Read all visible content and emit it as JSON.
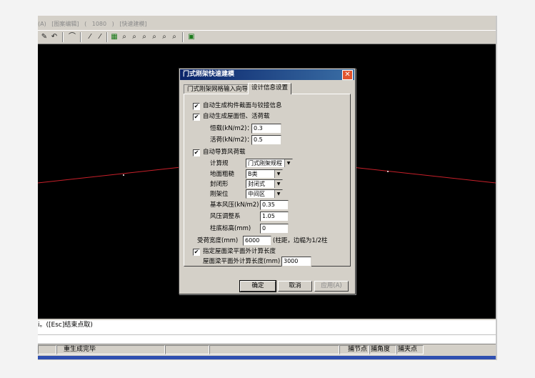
{
  "menubar": {
    "items": [
      "(A)",
      "[图案编辑]",
      "(",
      "1080",
      ")",
      "[快速建模]"
    ]
  },
  "toolbar": {
    "icons": [
      "paint-icon",
      "undo-icon",
      "arc-icon",
      "line-icon",
      "line2-icon",
      "grid-icon",
      "zoom-region-icon",
      "zoom-prev-icon",
      "zoom-all-icon",
      "zoom-in-icon",
      "zoom-out-icon",
      "pan-icon",
      "help-icon"
    ]
  },
  "dialog": {
    "title": "门式刚架快速建模",
    "close_glyph": "✕",
    "tabs": [
      "门式刚架网格输入向导",
      "设计信息设置"
    ],
    "opt_section_bolt": "自动生成构件截面与铰接信息",
    "opt_roof_load": "自动生成屋面恒、活荷载",
    "dead_load_label": "恒载(kN/m2)：",
    "dead_load_value": "0.3",
    "live_load_label": "活荷(kN/m2)：",
    "live_load_value": "0.5",
    "opt_wind": "自动导算风荷载",
    "code_label": "计算规",
    "code_value": "门式刚架规程",
    "rough_label": "地面粗糙",
    "rough_value": "B类",
    "enclose_label": "封闭形",
    "enclose_value": "封闭式",
    "frame_pos_label": "刚架位",
    "frame_pos_value": "中间区",
    "wind_press_label": "基本风压(kN/m2)",
    "wind_press_value": "0.35",
    "wind_adj_label": "风压调整系",
    "wind_adj_value": "1.05",
    "col_base_label": "柱底标高(mm)",
    "col_base_value": "0",
    "load_width_label": "受荷宽度(mm)",
    "load_width_value": "6000",
    "load_width_hint": "(柱距，边榀为1/2柱",
    "opt_outplane": "指定屋面梁平面外计算长度",
    "outplane_label": "屋面梁平面外计算长度(mm)",
    "outplane_value": "3000",
    "check_glyph": "✔",
    "ok_label": "确定",
    "cancel_label": "取消",
    "apply_label": "应用(A)"
  },
  "cmdline": {
    "text": "i。([Esc]结束点取)"
  },
  "statusbar": {
    "message": "重生成完毕",
    "snap_node": "捕节点",
    "snap_angle": "捕角度",
    "snap_mid": "捕夹点"
  },
  "colors": {
    "canvas": "#000000",
    "red_line": "#c8202a",
    "title_start": "#0a246a",
    "title_end": "#3a6ea5"
  }
}
